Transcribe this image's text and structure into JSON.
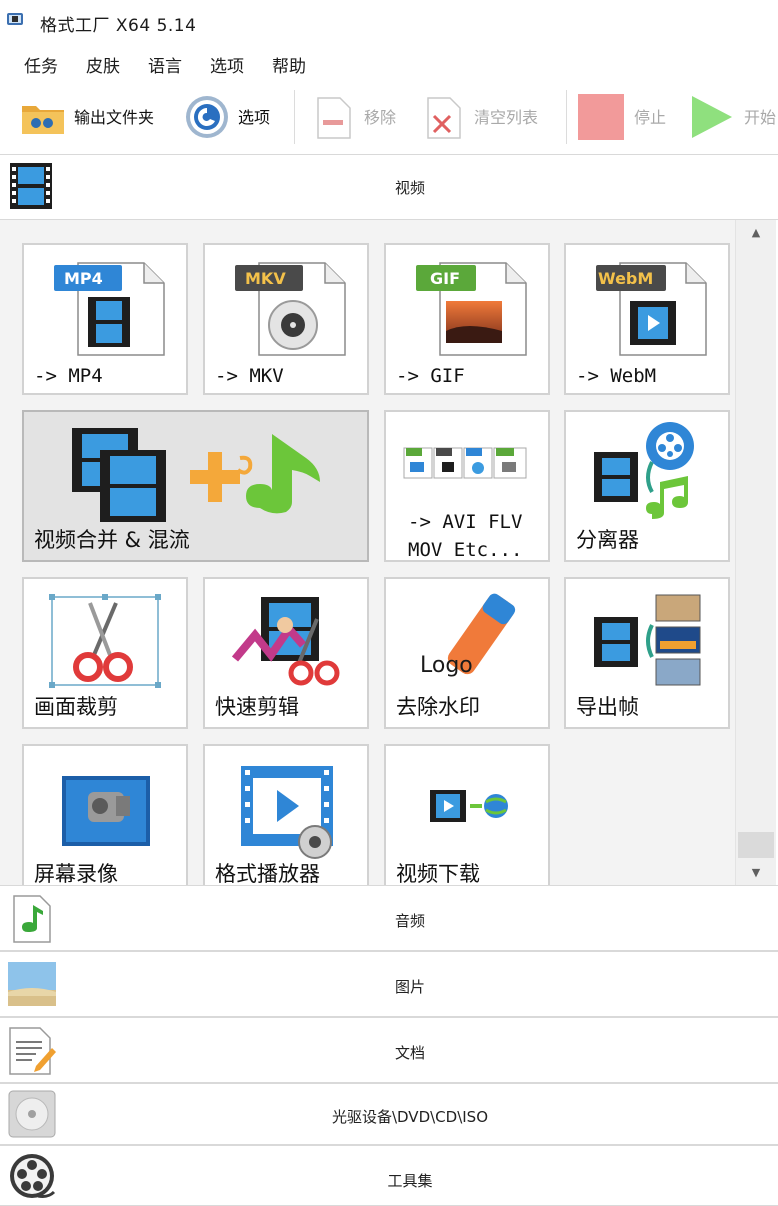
{
  "window": {
    "title": "格式工厂 X64 5.14"
  },
  "menu": [
    "任务",
    "皮肤",
    "语言",
    "选项",
    "帮助"
  ],
  "toolbar": {
    "output_folder": "输出文件夹",
    "options": "选项",
    "remove": "移除",
    "clear_list": "清空列表",
    "stop": "停止",
    "start": "开始"
  },
  "categories": {
    "video": "视频",
    "audio": "音频",
    "image": "图片",
    "document": "文档",
    "optical": "光驱设备\\DVD\\CD\\ISO",
    "tools": "工具集"
  },
  "tiles": {
    "mp4": {
      "badge": "MP4",
      "label": "-> MP4"
    },
    "mkv": {
      "badge": "MKV",
      "label": "-> MKV"
    },
    "gif": {
      "badge": "GIF",
      "label": "-> GIF"
    },
    "webm": {
      "badge": "WebM",
      "label": "-> WebM"
    },
    "merge": {
      "label": "视频合并 & 混流"
    },
    "avi": {
      "label_line1": "-> AVI FLV",
      "label_line2": "MOV Etc..."
    },
    "separator": {
      "label": "分离器"
    },
    "crop": {
      "label": "画面裁剪"
    },
    "quick_cut": {
      "label": "快速剪辑"
    },
    "watermark": {
      "label": "去除水印",
      "logo_text": "Logo"
    },
    "export_frames": {
      "label": "导出帧"
    },
    "screen_record": {
      "label": "屏幕录像"
    },
    "player": {
      "label": "格式播放器"
    },
    "download": {
      "label": "视频下载"
    }
  },
  "colors": {
    "accent_blue": "#2f86d6",
    "badge_dark": "#4a4a4a",
    "badge_green": "#5ba83a",
    "stop_red": "#f29a9a",
    "start_green": "#8fe07e",
    "grid_bg": "#f3f3f3"
  }
}
